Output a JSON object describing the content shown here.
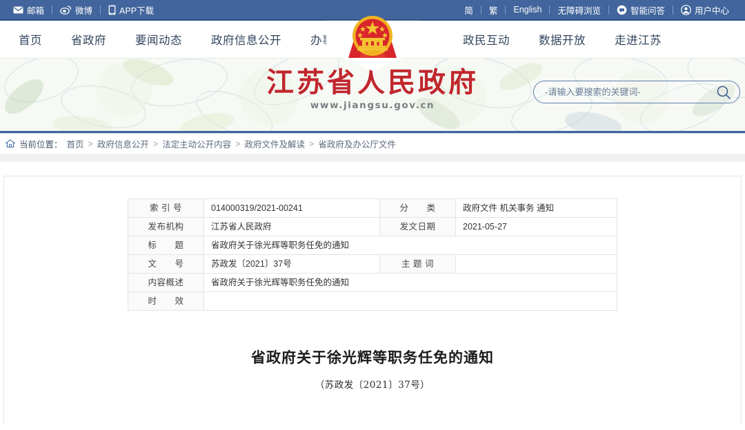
{
  "topbar": {
    "left_items": [
      {
        "label": "邮箱",
        "icon": "mail-icon"
      },
      {
        "label": "微博",
        "icon": "weibo-icon"
      },
      {
        "label": "APP下载",
        "icon": "phone-icon"
      }
    ],
    "right_items": [
      {
        "label": "简",
        "icon": ""
      },
      {
        "label": "繁",
        "icon": ""
      },
      {
        "label": "English",
        "icon": ""
      },
      {
        "label": "无障碍浏览",
        "icon": ""
      },
      {
        "label": "智能问答",
        "icon": "chat-icon"
      },
      {
        "label": "用户中心",
        "icon": "user-icon"
      }
    ]
  },
  "nav": {
    "left_items": [
      "首页",
      "省政府",
      "要闻动态",
      "政府信息公开",
      "办事服务"
    ],
    "right_items": [
      "政民互动",
      "数据开放",
      "走进江苏"
    ],
    "emblem": "national-emblem"
  },
  "hero": {
    "title_cn": "江苏省人民政府",
    "url": "www.jiangsu.gov.cn",
    "search_placeholder": "-请输入要搜索的关键词-",
    "search_value": "",
    "title_color": "#c0272d"
  },
  "breadcrumb": {
    "home_icon": "home-icon",
    "label": "当前位置：",
    "items": [
      "首页",
      "政府信息公开",
      "法定主动公开内容",
      "政府文件及解读",
      "省政府及办公厅文件"
    ],
    "separator": ">"
  },
  "meta_table": {
    "rows": [
      {
        "label1": "索 引 号",
        "value1": "014000319/2021-00241",
        "label2": "分　　类",
        "value2": "政府文件 机关事务 通知"
      },
      {
        "label1": "发布机构",
        "value1": "江苏省人民政府",
        "label2": "发文日期",
        "value2": "2021-05-27"
      },
      {
        "label1": "标　　题",
        "value1": "省政府关于徐光辉等职务任免的通知",
        "label2": null,
        "value2": null
      },
      {
        "label1": "文　　号",
        "value1": "苏政发〔2021〕37号",
        "label2": "主 题 词",
        "value2": ""
      },
      {
        "label1": "内容概述",
        "value1": "省政府关于徐光辉等职务任免的通知",
        "label2": null,
        "value2": null
      },
      {
        "label1": "时　　效",
        "value1": "",
        "label2": null,
        "value2": null
      }
    ]
  },
  "document": {
    "title": "省政府关于徐光辉等职务任免的通知",
    "subtitle": "（苏政发〔2021〕37号）"
  }
}
